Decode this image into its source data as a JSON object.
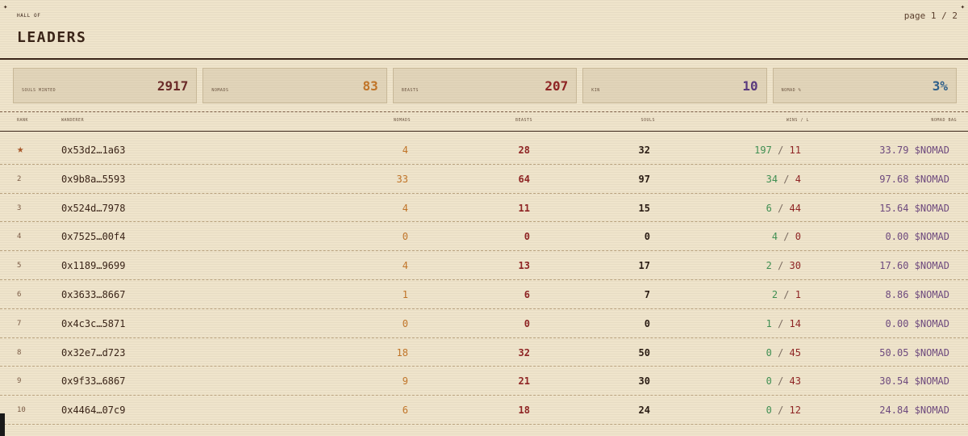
{
  "header": {
    "corner_left": "✦",
    "corner_right": "✦",
    "eyebrow": "HALL OF",
    "title": "LEADERS",
    "page_label": "page 1 / 2"
  },
  "stats": [
    {
      "label": "SOULS MINTED",
      "value": "2917",
      "color": "#6a2a28"
    },
    {
      "label": "NOMADS",
      "value": "83",
      "color": "#c07428"
    },
    {
      "label": "BEASTS",
      "value": "207",
      "color": "#8e2424"
    },
    {
      "label": "KIN",
      "value": "10",
      "color": "#5a3a7e"
    },
    {
      "label": "NOMAD %",
      "value": "3%",
      "color": "#2e5f8a"
    }
  ],
  "table": {
    "headers": {
      "rank": "RANK",
      "wanderer": "WANDERER",
      "nomads": "NOMADS",
      "beasts": "BEASTS",
      "souls": "SOULS",
      "wl": "WINS / L",
      "bag": "NOMAD BAG"
    },
    "rows": [
      {
        "rank": "★",
        "addr": "0x53d2…1a63",
        "nomads": "4",
        "beasts": "28",
        "souls": "32",
        "wins": "197",
        "losses": "11",
        "bag": "33.79 $NOMAD"
      },
      {
        "rank": "2",
        "addr": "0x9b8a…5593",
        "nomads": "33",
        "beasts": "64",
        "souls": "97",
        "wins": "34",
        "losses": "4",
        "bag": "97.68 $NOMAD"
      },
      {
        "rank": "3",
        "addr": "0x524d…7978",
        "nomads": "4",
        "beasts": "11",
        "souls": "15",
        "wins": "6",
        "losses": "44",
        "bag": "15.64 $NOMAD"
      },
      {
        "rank": "4",
        "addr": "0x7525…00f4",
        "nomads": "0",
        "beasts": "0",
        "souls": "0",
        "wins": "4",
        "losses": "0",
        "bag": "0.00 $NOMAD"
      },
      {
        "rank": "5",
        "addr": "0x1189…9699",
        "nomads": "4",
        "beasts": "13",
        "souls": "17",
        "wins": "2",
        "losses": "30",
        "bag": "17.60 $NOMAD"
      },
      {
        "rank": "6",
        "addr": "0x3633…8667",
        "nomads": "1",
        "beasts": "6",
        "souls": "7",
        "wins": "2",
        "losses": "1",
        "bag": "8.86 $NOMAD"
      },
      {
        "rank": "7",
        "addr": "0x4c3c…5871",
        "nomads": "0",
        "beasts": "0",
        "souls": "0",
        "wins": "1",
        "losses": "14",
        "bag": "0.00 $NOMAD"
      },
      {
        "rank": "8",
        "addr": "0x32e7…d723",
        "nomads": "18",
        "beasts": "32",
        "souls": "50",
        "wins": "0",
        "losses": "45",
        "bag": "50.05 $NOMAD"
      },
      {
        "rank": "9",
        "addr": "0x9f33…6867",
        "nomads": "9",
        "beasts": "21",
        "souls": "30",
        "wins": "0",
        "losses": "43",
        "bag": "30.54 $NOMAD"
      },
      {
        "rank": "10",
        "addr": "0x4464…07c9",
        "nomads": "6",
        "beasts": "18",
        "souls": "24",
        "wins": "0",
        "losses": "12",
        "bag": "24.84 $NOMAD"
      }
    ]
  }
}
